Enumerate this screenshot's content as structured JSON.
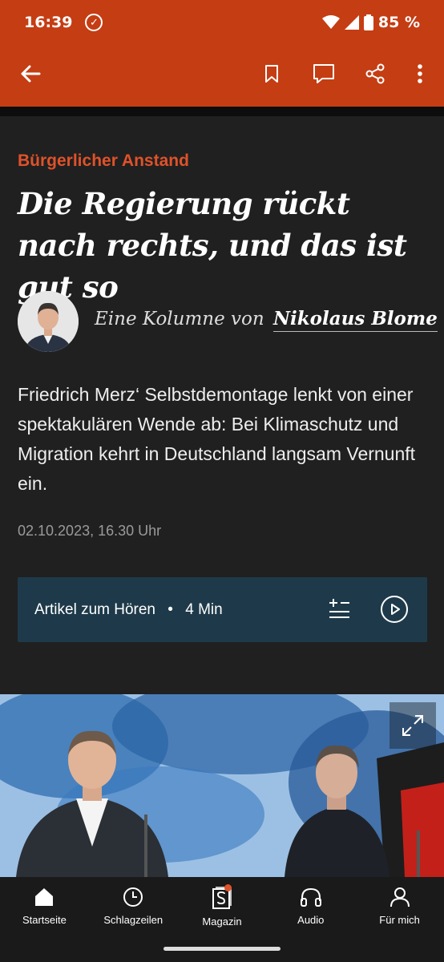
{
  "status_bar": {
    "time": "16:39",
    "battery": "85 %"
  },
  "article": {
    "kicker": "Bürgerlicher Anstand",
    "headline": "Die Regierung rückt nach rechts, und das ist gut so",
    "byline_prefix": "Eine Kolumne von",
    "author": "Nikolaus Blome",
    "teaser": "Friedrich Merz‘ Selbstdemontage lenkt von einer spektakulären Wende ab: Bei Klimaschutz und Migration kehrt in Deutschland langsam Vernunft ein.",
    "date": "02.10.2023, 16.30 Uhr"
  },
  "audio": {
    "label": "Artikel zum Hören",
    "separator": "•",
    "duration": "4 Min"
  },
  "nav": {
    "items": [
      {
        "label": "Startseite",
        "icon": "home-icon"
      },
      {
        "label": "Schlagzeilen",
        "icon": "clock-icon"
      },
      {
        "label": "Magazin",
        "icon": "magazin-icon"
      },
      {
        "label": "Audio",
        "icon": "headphones-icon"
      },
      {
        "label": "Für mich",
        "icon": "person-icon"
      }
    ]
  },
  "colors": {
    "brand": "#c53d13",
    "kicker": "#e0522a",
    "audio_bg": "#1e3a4a",
    "page_bg": "#202020"
  }
}
